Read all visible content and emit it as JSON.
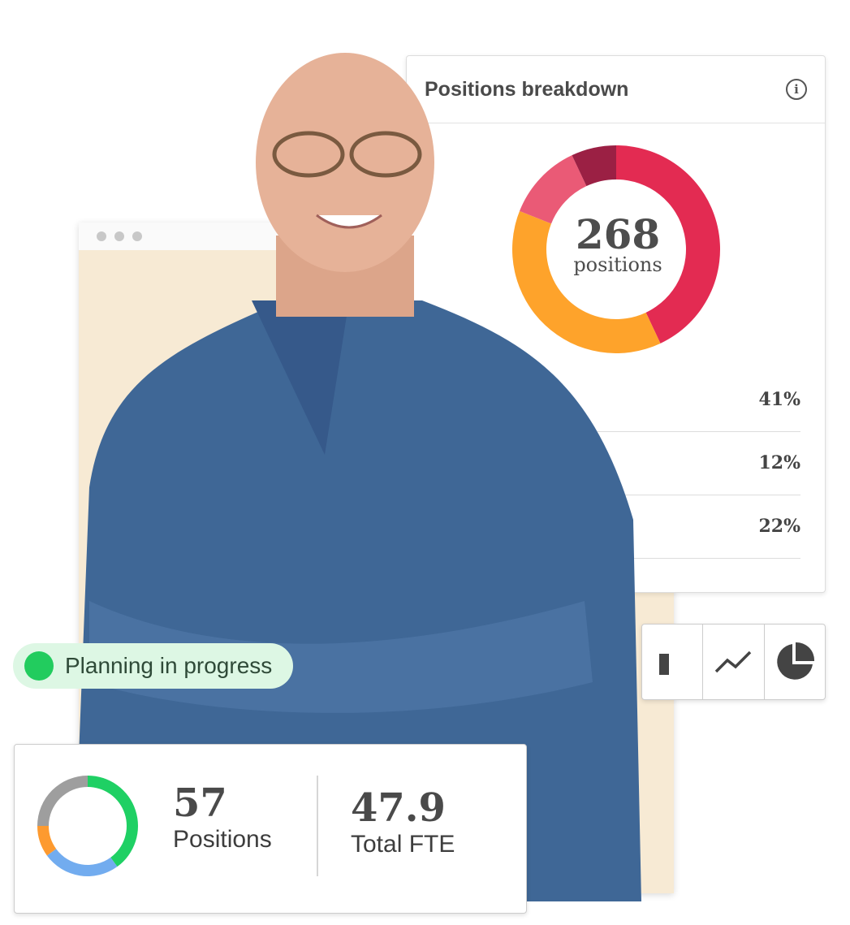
{
  "breakdown": {
    "title": "Positions breakdown",
    "info_icon": "info-icon",
    "total": "268",
    "total_label": "positions",
    "percentages": [
      "41%",
      "12%",
      "22%"
    ],
    "chart_data": {
      "type": "pie",
      "values": [
        43,
        38,
        12,
        7
      ],
      "colors": [
        "#e32b52",
        "#fea32b",
        "#ea5a76",
        "#9b2044"
      ]
    }
  },
  "toolbar": {
    "icons": [
      "bar-chart-icon",
      "line-chart-icon",
      "pie-chart-icon"
    ]
  },
  "status_badge": {
    "label": "Planning in progress",
    "color": "#22cc5e"
  },
  "summary": {
    "positions_value": "57",
    "positions_label": "Positions",
    "fte_value": "47.9",
    "fte_label": "Total FTE",
    "chart_data": {
      "type": "pie",
      "values": [
        40,
        25,
        10,
        25
      ],
      "colors": [
        "#1fd064",
        "#72acef",
        "#fd9a2f",
        "#9e9e9e"
      ]
    }
  }
}
